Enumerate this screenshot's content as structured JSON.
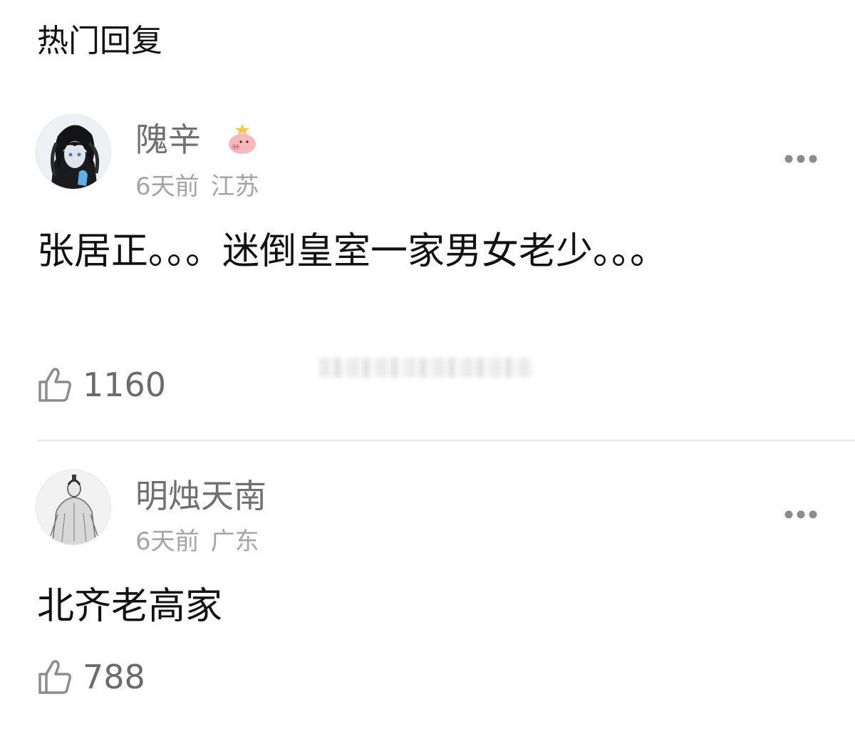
{
  "section": {
    "title": "热门回复"
  },
  "comments": [
    {
      "username": "隗辛",
      "time": "6天前",
      "location": "江苏",
      "content": "张居正。。。迷倒皇室一家男女老少。。。",
      "likes": "1160",
      "avatar_icon": "anime-boy-avatar",
      "badge_icon": "pig-badge-icon"
    },
    {
      "username": "明烛天南",
      "time": "6天前",
      "location": "广东",
      "content": "北齐老高家",
      "likes": "788",
      "avatar_icon": "sketch-figure-avatar"
    }
  ],
  "colors": {
    "username": "#707070",
    "meta": "#a5a5a5",
    "divider": "#e6e6e6",
    "icon": "#8c8c8c"
  }
}
